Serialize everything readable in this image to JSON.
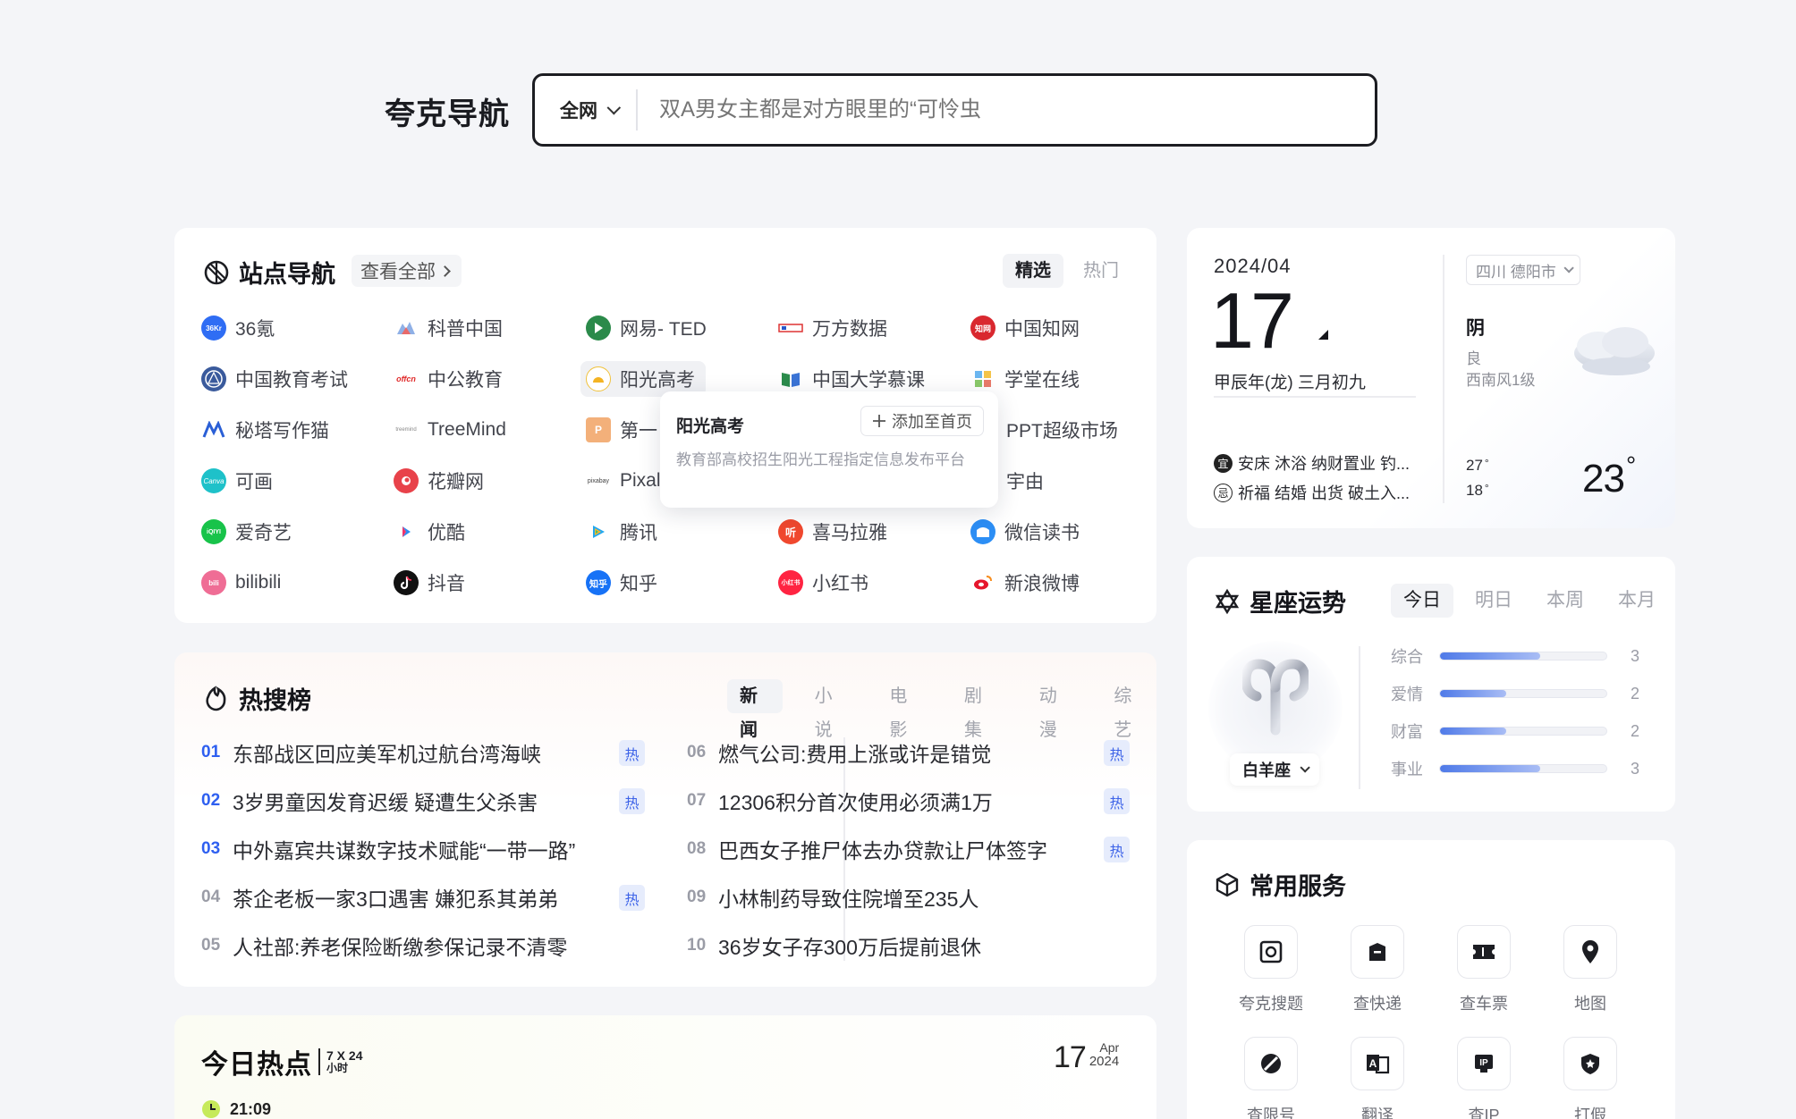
{
  "header": {
    "logo": "夸克导航",
    "search_scope": "全网",
    "search_placeholder": "双A男女主都是对方眼里的“可怜虫"
  },
  "site_nav": {
    "title": "站点导航",
    "view_all": "查看全部",
    "tabs": [
      "精选",
      "热门"
    ],
    "sites": [
      "36氪",
      "科普中国",
      "网易- TED",
      "万方数据",
      "中国知网",
      "中国教育考试",
      "中公教育",
      "阳光高考",
      "中国大学慕课",
      "学堂在线",
      "秘塔写作猫",
      "TreeMind",
      "第一",
      "PPT超级市场",
      "可画",
      "花瓣网",
      "Pixal",
      "宇由",
      "爱奇艺",
      "优酷",
      "腾讯",
      "喜马拉雅",
      "微信读书",
      "bilibili",
      "抖音",
      "知乎",
      "小红书",
      "新浪微博"
    ],
    "icon_texts": {
      "36kr": "36Kr",
      "zhiwang": "知网",
      "offcn": "offcn",
      "treemind": "treemind",
      "canva": "Canva",
      "iqiyi": "iQIYI",
      "pixabay": "pixabay",
      "ximalaya": "听",
      "zhihu": "知乎",
      "xhs": "小红书",
      "bilibili": "bili",
      "ygkk": "P"
    },
    "popup": {
      "title": "阳光高考",
      "add_button": "添加至首页",
      "desc": "教育部高校招生阳光工程指定信息发布平台"
    }
  },
  "hot_search": {
    "title": "热搜榜",
    "tabs": [
      "新闻",
      "小说",
      "电影",
      "剧集",
      "动漫",
      "综艺"
    ],
    "tag": "热",
    "items": [
      {
        "num": "01",
        "text": "东部战区回应美军机过航台湾海峡",
        "hot": true
      },
      {
        "num": "02",
        "text": "3岁男童因发育迟缓 疑遭生父杀害",
        "hot": true
      },
      {
        "num": "03",
        "text": "中外嘉宾共谋数字技术赋能“一带一路”",
        "hot": false
      },
      {
        "num": "04",
        "text": "茶企老板一家3口遇害 嫌犯系其弟弟",
        "hot": true
      },
      {
        "num": "05",
        "text": "人社部:养老保险断缴参保记录不清零",
        "hot": false
      },
      {
        "num": "06",
        "text": "燃气公司:费用上涨或许是错觉",
        "hot": true
      },
      {
        "num": "07",
        "text": "12306积分首次使用必须满1万",
        "hot": true
      },
      {
        "num": "08",
        "text": "巴西女子推尸体去办贷款让尸体签字",
        "hot": true
      },
      {
        "num": "09",
        "text": "小林制药导致住院增至235人",
        "hot": false
      },
      {
        "num": "10",
        "text": "36岁女子存300万后提前退休",
        "hot": false
      }
    ]
  },
  "today_hot": {
    "title": "今日热点",
    "badge_top": "7 X 24",
    "badge_bottom": "小时",
    "day": "17",
    "month": "Apr",
    "year": "2024",
    "time": "21:09"
  },
  "weather": {
    "year_month": "2024/04",
    "day": "17",
    "lunar": "甲辰年(龙) 三月初九",
    "yi_label": "宜",
    "yi": "安床 沐浴 纳财置业 钓...",
    "ji_label": "忌",
    "ji": "祈福 结婚 出货 破土入...",
    "location": "四川 德阳市",
    "condition": "阴",
    "air": "良",
    "wind": "西南风1级",
    "high": "27",
    "low": "18",
    "degree": "°",
    "current": "23"
  },
  "horoscope": {
    "title": "星座运势",
    "tabs": [
      "今日",
      "明日",
      "本周",
      "本月"
    ],
    "sign": "白羊座",
    "rows": [
      {
        "label": "综合",
        "score": 3
      },
      {
        "label": "爱情",
        "score": 2
      },
      {
        "label": "财富",
        "score": 2
      },
      {
        "label": "事业",
        "score": 3
      }
    ],
    "max_score": 5
  },
  "services": {
    "title": "常用服务",
    "items": [
      "夸克搜题",
      "查快递",
      "查车票",
      "地图",
      "查限号",
      "翻译",
      "查IP",
      "打假"
    ],
    "icon_texts": {
      "ip": "IP",
      "translate": "A"
    }
  },
  "colors": {
    "accent": "#2e5ff0",
    "hot_tag_bg": "#e6ecfc",
    "bar": "#4f7ae8"
  }
}
